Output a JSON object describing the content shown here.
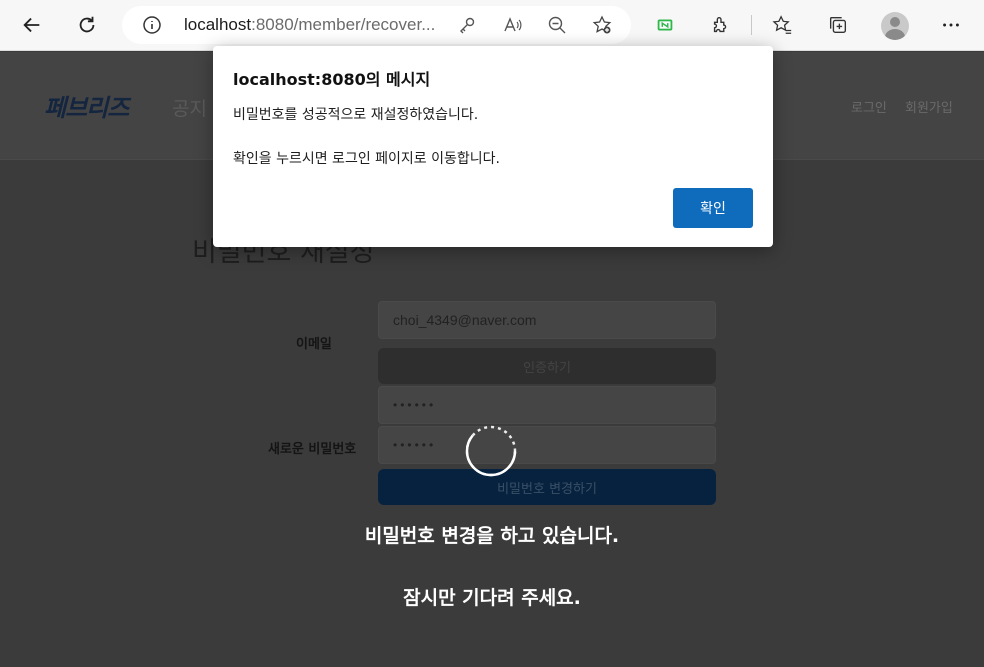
{
  "browser": {
    "url_host": "localhost",
    "url_rest": ":8080/member/recover..."
  },
  "site": {
    "logo": "페브리즈",
    "nav_notice": "공지",
    "login": "로그인",
    "signup": "회원가입",
    "page_title": "비밀번호 재설정"
  },
  "form": {
    "email_label": "이메일",
    "email_value": "choi_4349@naver.com",
    "verify_button": "인증하기",
    "password_value": "••••••",
    "password_confirm_value": "••••••",
    "new_password_label": "새로운 비밀번호",
    "change_button": "비밀번호 변경하기"
  },
  "loading": {
    "line1": "비밀번호 변경을 하고 있습니다.",
    "line2": "잠시만 기다려 주세요."
  },
  "dialog": {
    "title": "localhost:8080의 메시지",
    "line1": "비밀번호를 성공적으로 재설정하였습니다.",
    "line2": "확인을 누르시면 로그인 페이지로 이동합니다.",
    "ok_button": "확인"
  },
  "colors": {
    "dialog_button": "#0f6cbd",
    "overlay": "#3b3b3b"
  }
}
